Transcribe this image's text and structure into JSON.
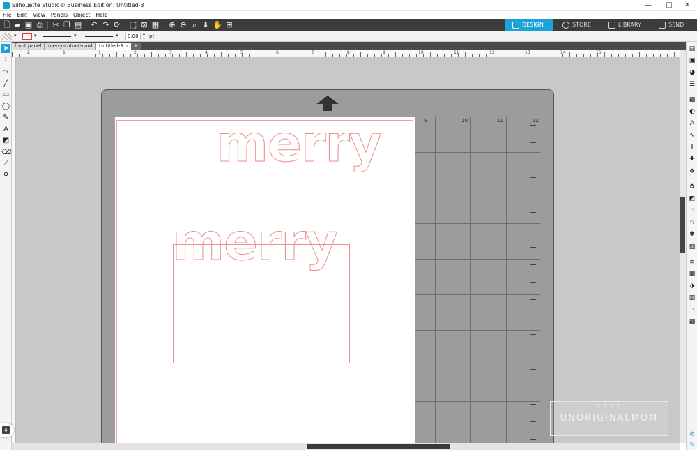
{
  "window": {
    "title": "Silhouette Studio® Business Edition: Untitled-3",
    "minimize": "—",
    "maximize": "□",
    "close": "✕"
  },
  "menu": [
    "File",
    "Edit",
    "View",
    "Panels",
    "Object",
    "Help"
  ],
  "nav_tabs": [
    {
      "label": "DESIGN",
      "active": true
    },
    {
      "label": "STORE",
      "active": false
    },
    {
      "label": "LIBRARY",
      "active": false
    },
    {
      "label": "SEND",
      "active": false
    }
  ],
  "options_bar": {
    "line_width_value": "0.00",
    "line_width_unit": "pt"
  },
  "doc_tabs": [
    {
      "label": "front panel",
      "active": false
    },
    {
      "label": "merry-cutout-card",
      "active": false
    },
    {
      "label": "Untitled-3",
      "active": true,
      "close": "×"
    }
  ],
  "add_tab": "+",
  "ruler_numbers": [
    "2",
    "1",
    "1",
    "2",
    "3",
    "4",
    "5",
    "6",
    "7",
    "8",
    "9",
    "10",
    "11",
    "12",
    "13",
    "14",
    "15"
  ],
  "mat_column_numbers": [
    "9",
    "10",
    "11",
    "12"
  ],
  "design": {
    "text_top": "merry",
    "text_bottom": "merry"
  },
  "watermark": {
    "dots": "⁝ ⁝ ⁝ ⁝",
    "text": "UNORIGINALMOM"
  },
  "colors": {
    "accent": "#1aa3d6",
    "cut_line": "#ef8a8a",
    "toolbar_bg": "#3b3b3b",
    "mat": "#9c9c9c"
  }
}
